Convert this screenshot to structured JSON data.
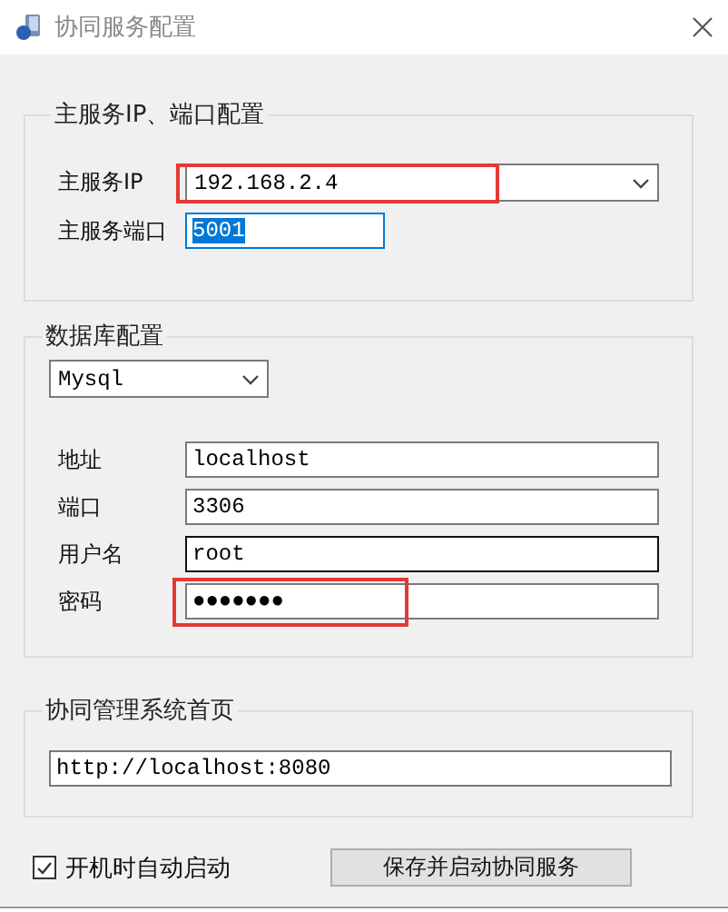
{
  "window": {
    "title": "协同服务配置"
  },
  "server_group": {
    "legend": "主服务IP、端口配置",
    "ip": {
      "label": "主服务IP",
      "value": "192.168.2.4",
      "highlighted": true
    },
    "port": {
      "label": "主服务端口",
      "value": "5001",
      "focused": true
    }
  },
  "database_group": {
    "legend": "数据库配置",
    "db_type": "Mysql",
    "fields": [
      {
        "label": "地址",
        "value": "localhost",
        "hovered": false,
        "highlighted": false
      },
      {
        "label": "端口",
        "value": "3306",
        "hovered": false,
        "highlighted": false
      },
      {
        "label": "用户名",
        "value": "root",
        "hovered": true,
        "highlighted": false
      },
      {
        "label": "密码",
        "value": "●●●●●●●",
        "hovered": false,
        "highlighted": true
      }
    ]
  },
  "homepage_group": {
    "legend": "协同管理系统首页",
    "url": "http://localhost:8080"
  },
  "autostart": {
    "label": "开机时自动启动",
    "checked": true
  },
  "button": "保存并启动协同服务"
}
